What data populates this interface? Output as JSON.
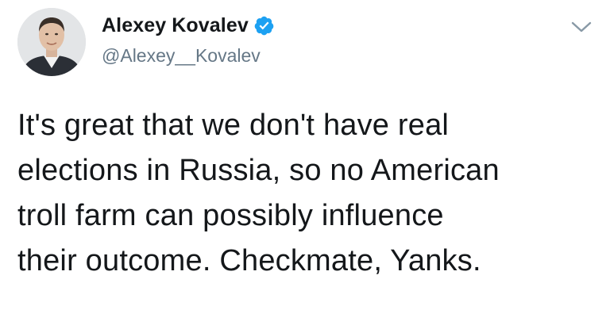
{
  "author": {
    "display_name": "Alexey Kovalev",
    "handle": "@Alexey__Kovalev",
    "verified": true
  },
  "tweet": {
    "text": "It's great that we don't have real\nelections in Russia, so no American\ntroll farm can possibly influence\ntheir outcome. Checkmate, Yanks."
  },
  "icons": {
    "verified": "verified-badge-icon",
    "menu": "chevron-down-icon",
    "avatar": "profile-photo"
  },
  "colors": {
    "verified_blue": "#1da1f2",
    "handle_gray": "#657786",
    "text": "#14171a"
  }
}
